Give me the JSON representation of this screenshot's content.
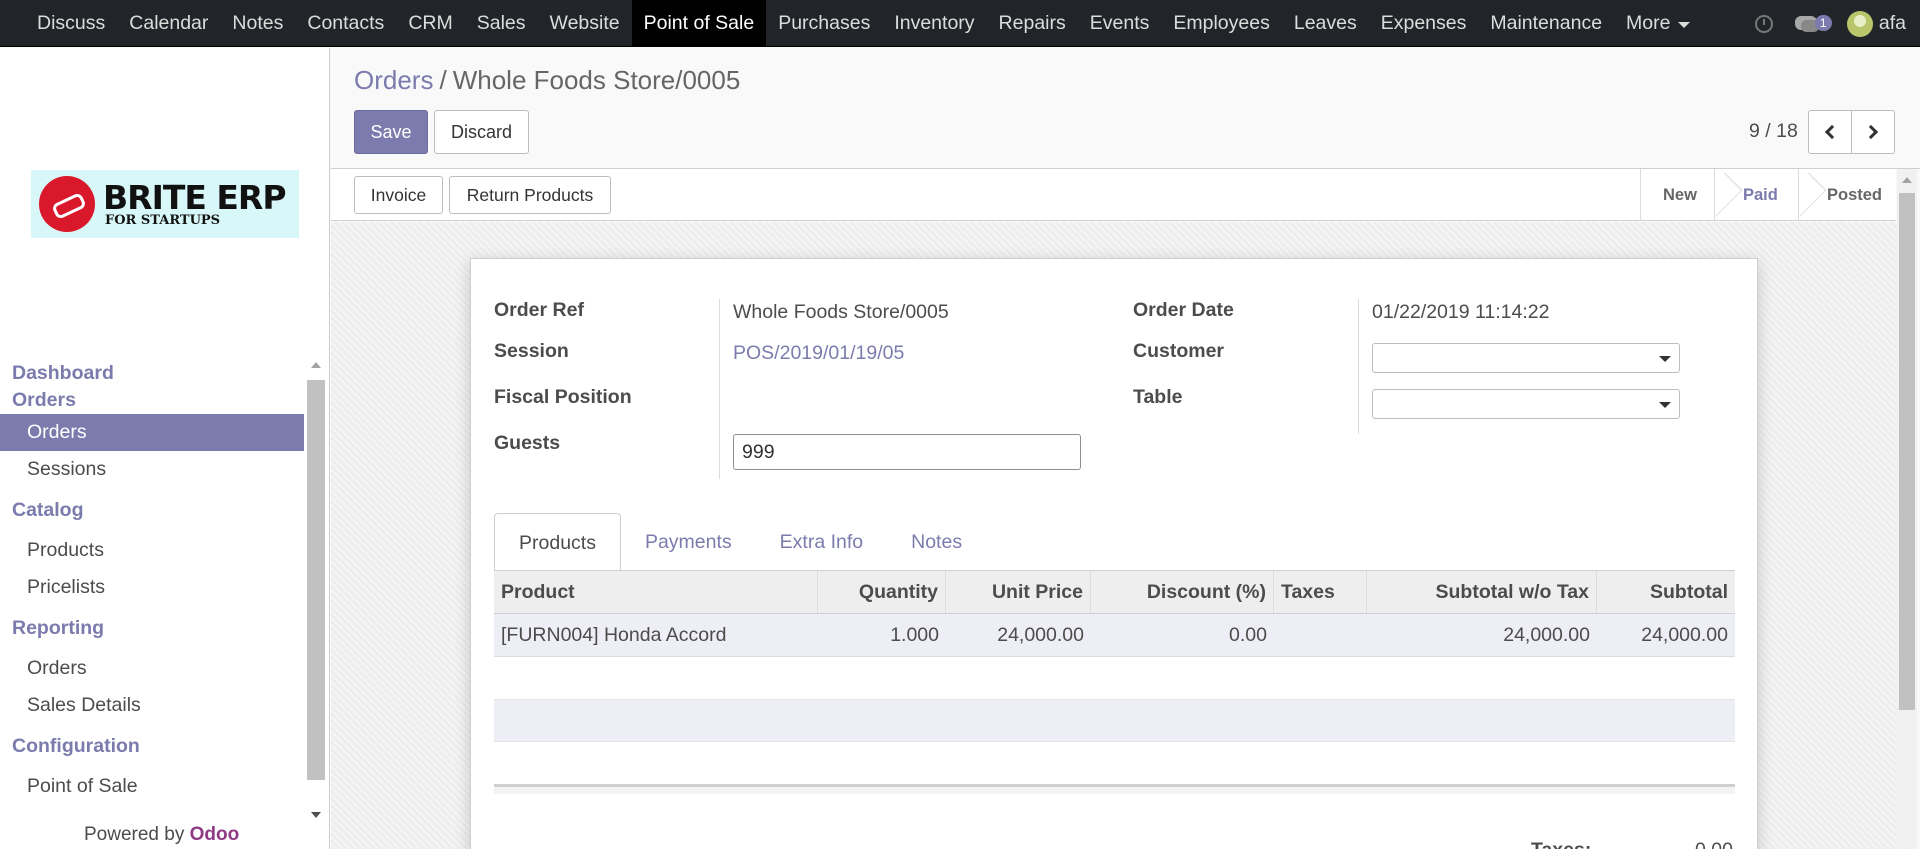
{
  "navbar": {
    "items": [
      "Discuss",
      "Calendar",
      "Notes",
      "Contacts",
      "CRM",
      "Sales",
      "Website",
      "Point of Sale",
      "Purchases",
      "Inventory",
      "Repairs",
      "Events",
      "Employees",
      "Leaves",
      "Expenses",
      "Maintenance"
    ],
    "active": "Point of Sale",
    "more_label": "More",
    "chat_count": "1",
    "user_name": "afa"
  },
  "sidebar": {
    "logo_brand": "BRITE ERP",
    "logo_tagline": "FOR STARTUPS",
    "sections": [
      {
        "title": "Dashboard",
        "items": []
      },
      {
        "title": "Orders",
        "items": [
          "Orders",
          "Sessions"
        ]
      },
      {
        "title": "Catalog",
        "items": [
          "Products",
          "Pricelists"
        ]
      },
      {
        "title": "Reporting",
        "items": [
          "Orders",
          "Sales Details"
        ]
      },
      {
        "title": "Configuration",
        "items": [
          "Point of Sale"
        ]
      }
    ],
    "active_item": "Orders",
    "powered_by": "Powered by",
    "powered_brand": "Odoo"
  },
  "control_panel": {
    "breadcrumb_parent": "Orders",
    "breadcrumb_sep": "/",
    "breadcrumb_current": "Whole Foods Store/0005",
    "save_label": "Save",
    "discard_label": "Discard",
    "pager": "9 / 18"
  },
  "statusbar": {
    "invoice_label": "Invoice",
    "return_label": "Return Products",
    "stages": [
      "New",
      "Paid",
      "Posted"
    ],
    "active_stage": "Paid"
  },
  "form": {
    "order_ref_label": "Order Ref",
    "order_ref_value": "Whole Foods Store/0005",
    "session_label": "Session",
    "session_value": "POS/2019/01/19/05",
    "fiscal_position_label": "Fiscal Position",
    "guests_label": "Guests",
    "guests_value": "999",
    "order_date_label": "Order Date",
    "order_date_value": "01/22/2019 11:14:22",
    "customer_label": "Customer",
    "customer_value": "",
    "table_label": "Table",
    "table_value": ""
  },
  "tabs": [
    "Products",
    "Payments",
    "Extra Info",
    "Notes"
  ],
  "active_tab": "Products",
  "lines_table": {
    "columns": [
      "Product",
      "Quantity",
      "Unit Price",
      "Discount (%)",
      "Taxes",
      "Subtotal w/o Tax",
      "Subtotal"
    ],
    "rows": [
      [
        "[FURN004] Honda Accord",
        "1.000",
        "24,000.00",
        "0.00",
        "",
        "24,000.00",
        "24,000.00"
      ]
    ]
  },
  "totals": {
    "taxes_label": "Taxes:",
    "taxes_value": "0.00"
  },
  "colors": {
    "brand": "#7c7bad",
    "navbar_bg": "#212529",
    "logo_red": "#d9182b",
    "logo_bg": "#d8f7f9"
  }
}
